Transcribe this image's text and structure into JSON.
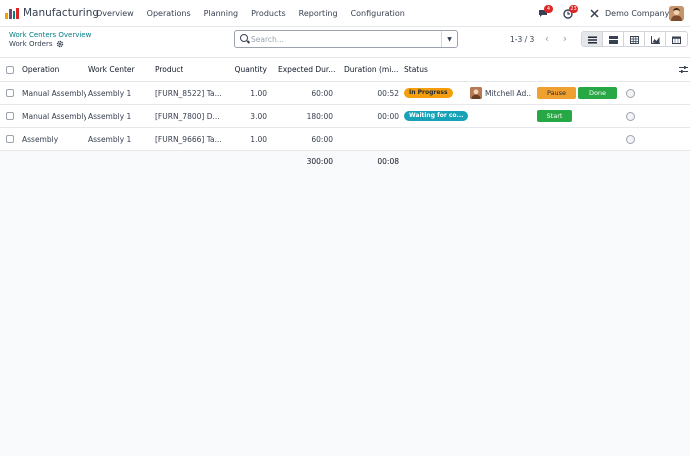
{
  "colors": {
    "accent": "#017e84",
    "primary": "#714b67",
    "in_progress": "#f59e0b",
    "waiting": "#17a2b8",
    "pause": "#f0a030",
    "done": "#28a745",
    "start": "#28a745"
  },
  "navbar": {
    "app_name": "Manufacturing",
    "menu": [
      "Overview",
      "Operations",
      "Planning",
      "Products",
      "Reporting",
      "Configuration"
    ],
    "messages_count": "4",
    "activities_count": "23",
    "company": "Demo Company"
  },
  "breadcrumb": {
    "parent": "Work Centers Overview",
    "current": "Work Orders"
  },
  "search": {
    "placeholder": "Search...",
    "value": ""
  },
  "pager": {
    "range": "1-3 / 3"
  },
  "views": [
    "list-icon",
    "kanban-icon",
    "pivot-icon",
    "graph-icon",
    "calendar-icon"
  ],
  "table": {
    "headers": {
      "operation": "Operation",
      "work_center": "Work Center",
      "product": "Product",
      "quantity": "Quantity",
      "expected_duration": "Expected Dur...",
      "duration": "Duration (mi...",
      "status": "Status"
    },
    "rows": [
      {
        "operation": "Manual Assembly",
        "work_center": "Assembly 1",
        "product": "[FURN_8522] Ta...",
        "quantity": "1.00",
        "expected_duration": "60:00",
        "duration": "00:52",
        "status": "In Progress",
        "worker": "Mitchell Ad...",
        "pause_label": "Pause",
        "done_label": "Done"
      },
      {
        "operation": "Manual Assembly",
        "work_center": "Assembly 1",
        "product": "[FURN_7800] D...",
        "quantity": "3.00",
        "expected_duration": "180:00",
        "duration": "00:00",
        "status": "Waiting for co...",
        "start_label": "Start"
      },
      {
        "operation": "Assembly",
        "work_center": "Assembly 1",
        "product": "[FURN_9666] Ta...",
        "quantity": "1.00",
        "expected_duration": "60:00",
        "duration": ""
      }
    ],
    "totals": {
      "expected_duration": "300:00",
      "duration": "00:08"
    }
  }
}
